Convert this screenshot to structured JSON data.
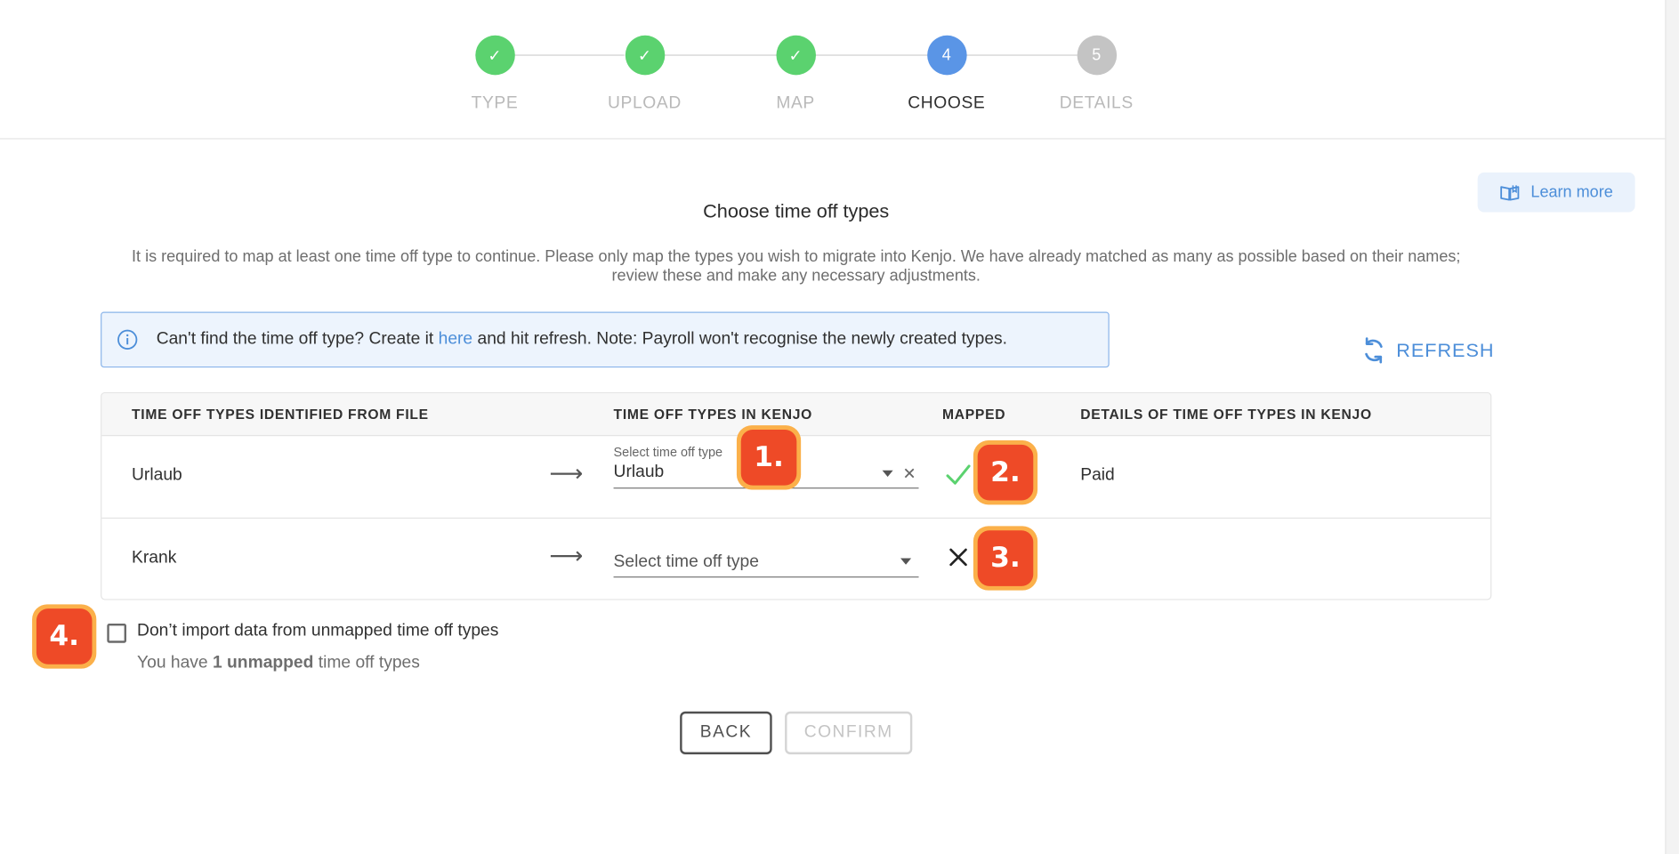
{
  "stepper": {
    "steps": [
      {
        "number": "1",
        "label": "TYPE",
        "state": "done"
      },
      {
        "number": "2",
        "label": "UPLOAD",
        "state": "done"
      },
      {
        "number": "3",
        "label": "MAP",
        "state": "done"
      },
      {
        "number": "4",
        "label": "CHOOSE",
        "state": "active"
      },
      {
        "number": "5",
        "label": "DETAILS",
        "state": "pending"
      }
    ],
    "check_glyph": "✓"
  },
  "learn_more": {
    "label": "Learn more",
    "icon": "book-icon"
  },
  "title": "Choose time off types",
  "description": "It is required to map at least one time off type to continue. Please only map the types you wish to migrate into Kenjo. We have already matched as many as possible based on their names; review these and make any necessary adjustments.",
  "info": {
    "before_link": "Can't find the time off type? Create it ",
    "link_text": "here",
    "after_link": " and hit refresh. Note: Payroll won't recognise the newly created types."
  },
  "refresh_label": "REFRESH",
  "table": {
    "headers": {
      "from_file": "TIME OFF TYPES IDENTIFIED FROM FILE",
      "in_kenjo": "TIME OFF TYPES IN KENJO",
      "mapped": "MAPPED",
      "details": "DETAILS OF TIME OFF TYPES IN KENJO"
    },
    "arrow_glyph": "⟶",
    "rows": [
      {
        "source": "Urlaub",
        "select_label": "Select time off type",
        "selected": "Urlaub",
        "mapped": true,
        "mapped_glyph": "✓",
        "details": "Paid"
      },
      {
        "source": "Krank",
        "placeholder": "Select time off type",
        "selected": "",
        "mapped": false,
        "mapped_glyph": "✕",
        "details": ""
      }
    ],
    "clear_glyph": "✕"
  },
  "callouts": [
    "1.",
    "2.",
    "3.",
    "4."
  ],
  "unmapped": {
    "checkbox_label": "Don’t import data from unmapped time off types",
    "note_prefix": "You have ",
    "note_count": "1 unmapped",
    "note_suffix": " time off types"
  },
  "buttons": {
    "back": "BACK",
    "confirm": "CONFIRM"
  },
  "colors": {
    "success": "#5bd26f",
    "active": "#5a95e6",
    "pending": "#c4c4c4",
    "link": "#4c8ed9",
    "callout_fill": "#ee4a27",
    "callout_border": "#fbb04a"
  }
}
